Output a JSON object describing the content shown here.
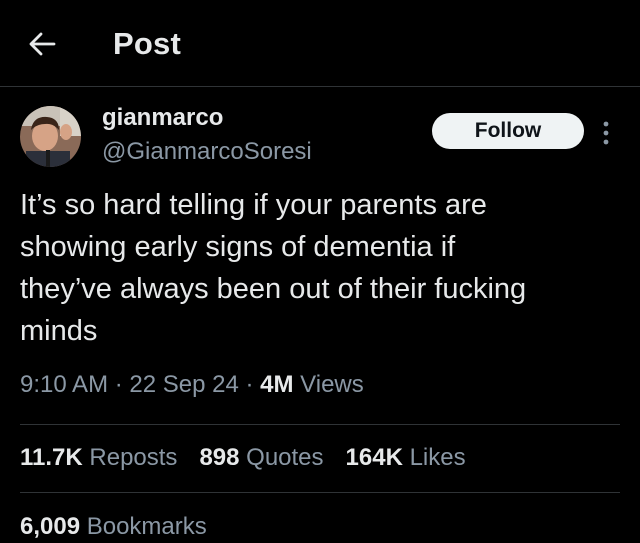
{
  "header": {
    "back_icon": "arrow-left-icon",
    "title": "Post"
  },
  "author": {
    "display_name": "gianmarco",
    "handle": "@GianmarcoSoresi",
    "avatar_icon": "avatar-photo"
  },
  "follow_label": "Follow",
  "more_icon": "vertical-ellipsis-icon",
  "tweet": {
    "lines": [
      "It’s so hard telling if your parents are",
      "showing early signs of dementia if",
      "they’ve always been out of their fucking",
      "minds"
    ]
  },
  "meta": {
    "time": "9:10 AM",
    "sep1": " · ",
    "date": "22 Sep 24",
    "sep2": " · ",
    "views_count": "4M",
    "views_label": " Views"
  },
  "stats": {
    "reposts_count": "11.7K",
    "reposts_label": " Reposts",
    "quotes_count": "898",
    "quotes_label": " Quotes",
    "likes_count": "164K",
    "likes_label": " Likes",
    "bookmarks_count": "6,009",
    "bookmarks_label": " Bookmarks"
  },
  "colors": {
    "background": "#000000",
    "text_primary": "#e7e9ea",
    "text_secondary": "#8b98a5",
    "divider": "#2f3336",
    "follow_bg": "#eff3f4"
  }
}
